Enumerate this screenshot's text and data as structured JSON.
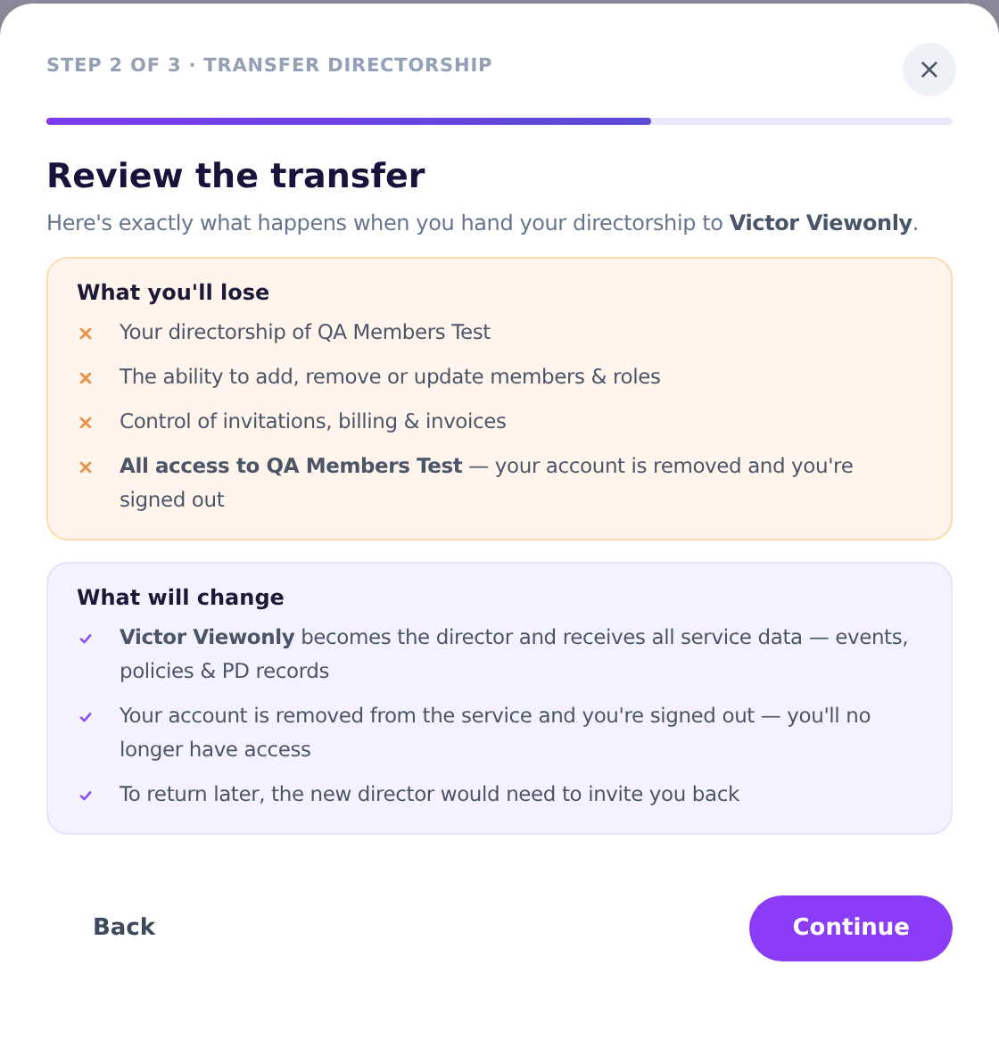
{
  "header": {
    "step_label": "STEP 2 OF 3 · TRANSFER DIRECTORSHIP",
    "close": "×"
  },
  "progress": {
    "level": 0.667
  },
  "title": "Review the transfer",
  "intro": "Here's exactly what happens when you hand your directorship to **Victor Viewonly**.",
  "sections": [
    {
      "kind": "loss",
      "heading": "What you'll lose",
      "items": [
        "Your directorship of QA Members Test",
        "The ability to add, remove or update members & roles",
        "Control of invitations, billing & invoices",
        "**All access to QA Members Test** — your account is removed and you're signed out"
      ]
    },
    {
      "kind": "change",
      "heading": "What will change",
      "items": [
        "**Victor Viewonly** becomes the director and receives all service data — events, policies & PD records",
        "Your account is removed from the service and you're signed out — you'll no longer have access",
        "To return later, the new director would need to invite you back"
      ]
    }
  ],
  "buttons": {
    "back": "Back",
    "continue": "Continue"
  }
}
